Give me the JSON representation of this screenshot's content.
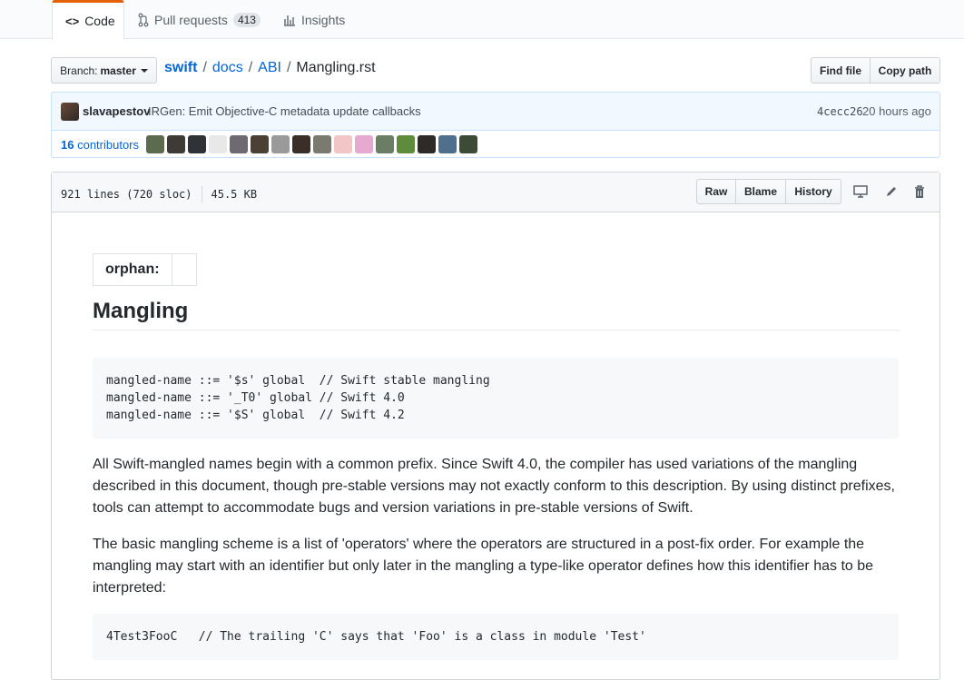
{
  "tabs": {
    "code": "Code",
    "pull_requests": "Pull requests",
    "pull_requests_count": "413",
    "insights": "Insights"
  },
  "breadcrumb": {
    "branch_label": "Branch:",
    "branch": "master",
    "repo": "swift",
    "sep": "/",
    "dir1": "docs",
    "dir2": "ABI",
    "file": "Mangling.rst"
  },
  "toolbar": {
    "find_file": "Find file",
    "copy_path": "Copy path"
  },
  "commit": {
    "author": "slavapestov",
    "message": "IRGen: Emit Objective-C metadata update callbacks",
    "sha": "4cecc26",
    "age": "20 hours ago",
    "contributors_count": "16",
    "contributors_label": "contributors"
  },
  "file": {
    "lines": "921 lines (720 sloc)",
    "size": "45.5 KB",
    "raw": "Raw",
    "blame": "Blame",
    "history": "History"
  },
  "content": {
    "field_name": "orphan:",
    "heading": "Mangling",
    "code1": "mangled-name ::= '$s' global  // Swift stable mangling\nmangled-name ::= '_T0' global // Swift 4.0\nmangled-name ::= '$S' global  // Swift 4.2",
    "para1": "All Swift-mangled names begin with a common prefix. Since Swift 4.0, the compiler has used variations of the mangling described in this document, though pre-stable versions may not exactly conform to this description. By using distinct prefixes, tools can attempt to accommodate bugs and version variations in pre-stable versions of Swift.",
    "para2": "The basic mangling scheme is a list of 'operators' where the operators are structured in a post-fix order. For example the mangling may start with an identifier but only later in the mangling a type-like operator defines how this identifier has to be interpreted:",
    "code2": "4Test3FooC   // The trailing 'C' says that 'Foo' is a class in module 'Test'"
  },
  "colors": {
    "accent_tab": "#e36209",
    "link": "#0366d6",
    "commit_bg": "#f1f8ff",
    "code_bg": "#f6f8fa"
  },
  "icons": {
    "code": "code-icon",
    "pull_request": "git-pull-request-icon",
    "insights": "graph-icon",
    "display": "desktop-icon",
    "edit": "pencil-icon",
    "delete": "trash-icon"
  }
}
